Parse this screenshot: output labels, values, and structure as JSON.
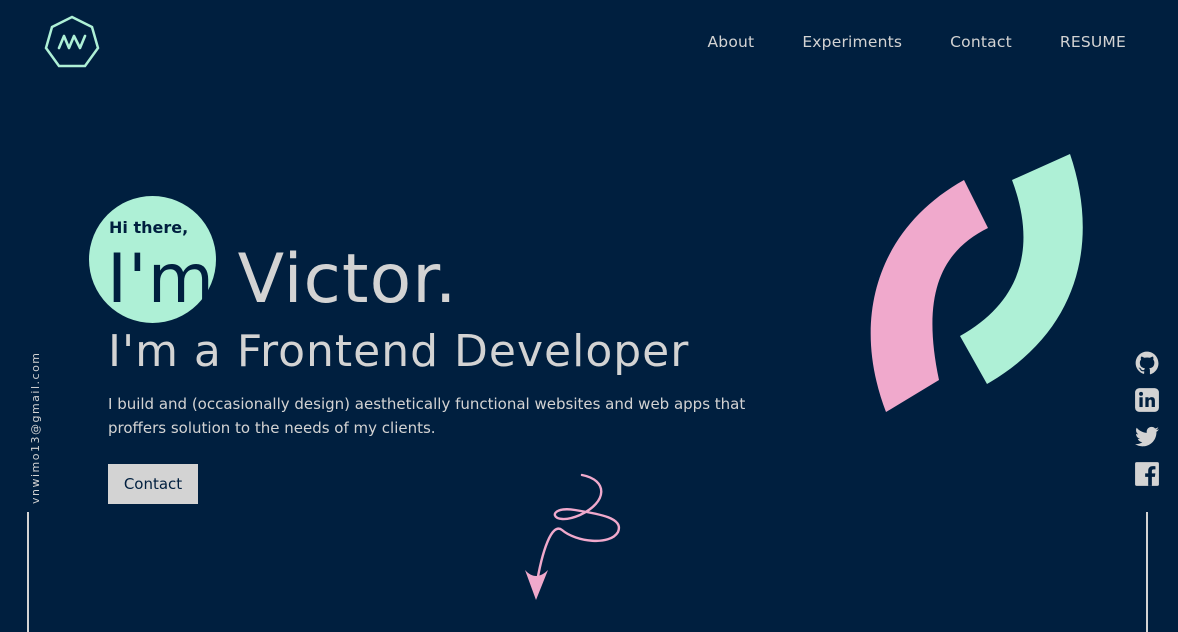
{
  "colors": {
    "background": "#001f3f",
    "text": "#d3d3d3",
    "mint": "#aef0d6",
    "pink": "#f0a9cc"
  },
  "logo": {
    "icon": "hexagon-va-logo-icon"
  },
  "nav": {
    "items": [
      "About",
      "Experiments",
      "Contact",
      "RESUME"
    ]
  },
  "hero": {
    "greeting": "Hi there,",
    "name_prefix": "I'm",
    "name": "Victor.",
    "role": "I'm a Frontend Developer",
    "description": "I build and (occasionally design) aesthetically functional websites and web apps that proffers solution to the needs of my clients.",
    "cta_label": "Contact"
  },
  "sidebar": {
    "email": "vnwimo13@gmail.com"
  },
  "social": {
    "icons": [
      "github-icon",
      "linkedin-icon",
      "twitter-icon",
      "facebook-icon"
    ]
  }
}
